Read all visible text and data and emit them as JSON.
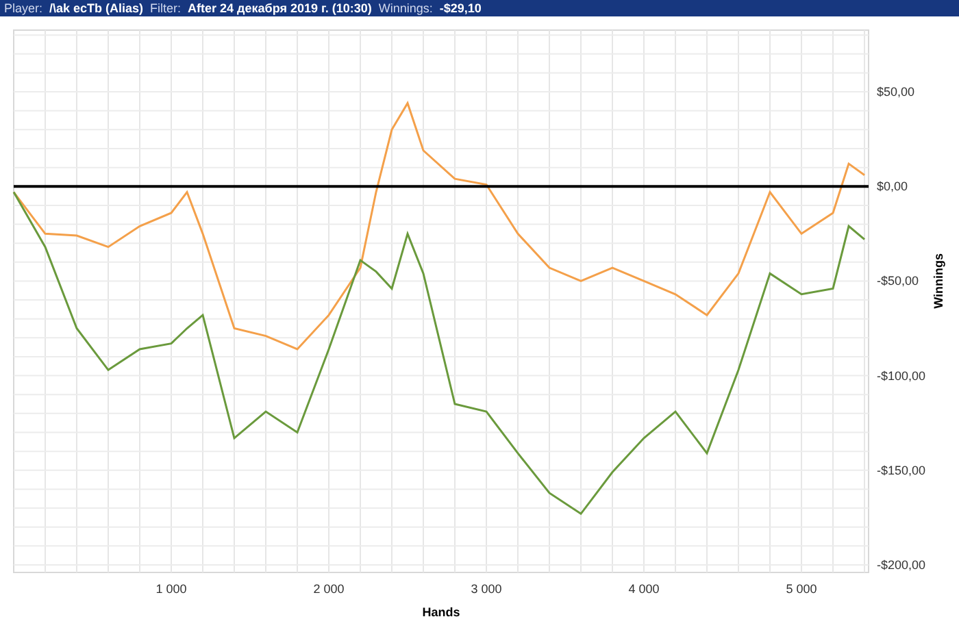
{
  "header": {
    "fields": [
      {
        "label": "Player:",
        "value": "/\\ak ecTb (Alias)"
      },
      {
        "label": "Filter:",
        "value": "After 24 декабря 2019 г. (10:30)"
      },
      {
        "label": "Winnings:",
        "value": "-$29,10"
      }
    ]
  },
  "chart_data": {
    "type": "line",
    "grid": true,
    "xlabel": "Hands",
    "ylabel": "Winnings",
    "x": [
      0,
      200,
      400,
      600,
      800,
      1000,
      1100,
      1200,
      1400,
      1600,
      1800,
      2000,
      2200,
      2300,
      2400,
      2500,
      2600,
      2800,
      3000,
      3200,
      3400,
      3600,
      3800,
      4000,
      4200,
      4400,
      4600,
      4800,
      5000,
      5200,
      5300,
      5400
    ],
    "series": [
      {
        "color": "#f4a04a",
        "values": [
          -3,
          -25,
          -26,
          -32,
          -21,
          -14,
          -3,
          -25,
          -75,
          -79,
          -86,
          -68,
          -43,
          -3,
          30,
          44,
          19,
          4,
          1,
          -25,
          -43,
          -50,
          -43,
          -50,
          -57,
          -68,
          -46,
          -3,
          -25,
          -14,
          12,
          6
        ]
      },
      {
        "color": "#6a9a3c",
        "values": [
          -3,
          -32,
          -75,
          -97,
          -86,
          -83,
          -75,
          -68,
          -133,
          -119,
          -130,
          -86,
          -39,
          -45,
          -54,
          -25,
          -46,
          -115,
          -119,
          -141,
          -162,
          -173,
          -151,
          -133,
          -119,
          -141,
          -97,
          -46,
          -57,
          -54,
          -21,
          -28
        ]
      }
    ],
    "xlim": [
      0,
      5426
    ],
    "ylim": [
      -204,
      82.6
    ],
    "xticks": [
      {
        "value": 1000,
        "label": "1 000"
      },
      {
        "value": 2000,
        "label": "2 000"
      },
      {
        "value": 3000,
        "label": "3 000"
      },
      {
        "value": 4000,
        "label": "4 000"
      },
      {
        "value": 5000,
        "label": "5 000"
      }
    ],
    "yticks": [
      {
        "value": 50,
        "label": "$50,00"
      },
      {
        "value": 0,
        "label": "$0,00"
      },
      {
        "value": -50,
        "label": "-$50,00"
      },
      {
        "value": -100,
        "label": "-$100,00"
      },
      {
        "value": -150,
        "label": "-$150,00"
      },
      {
        "value": -200,
        "label": "-$200,00"
      }
    ]
  }
}
